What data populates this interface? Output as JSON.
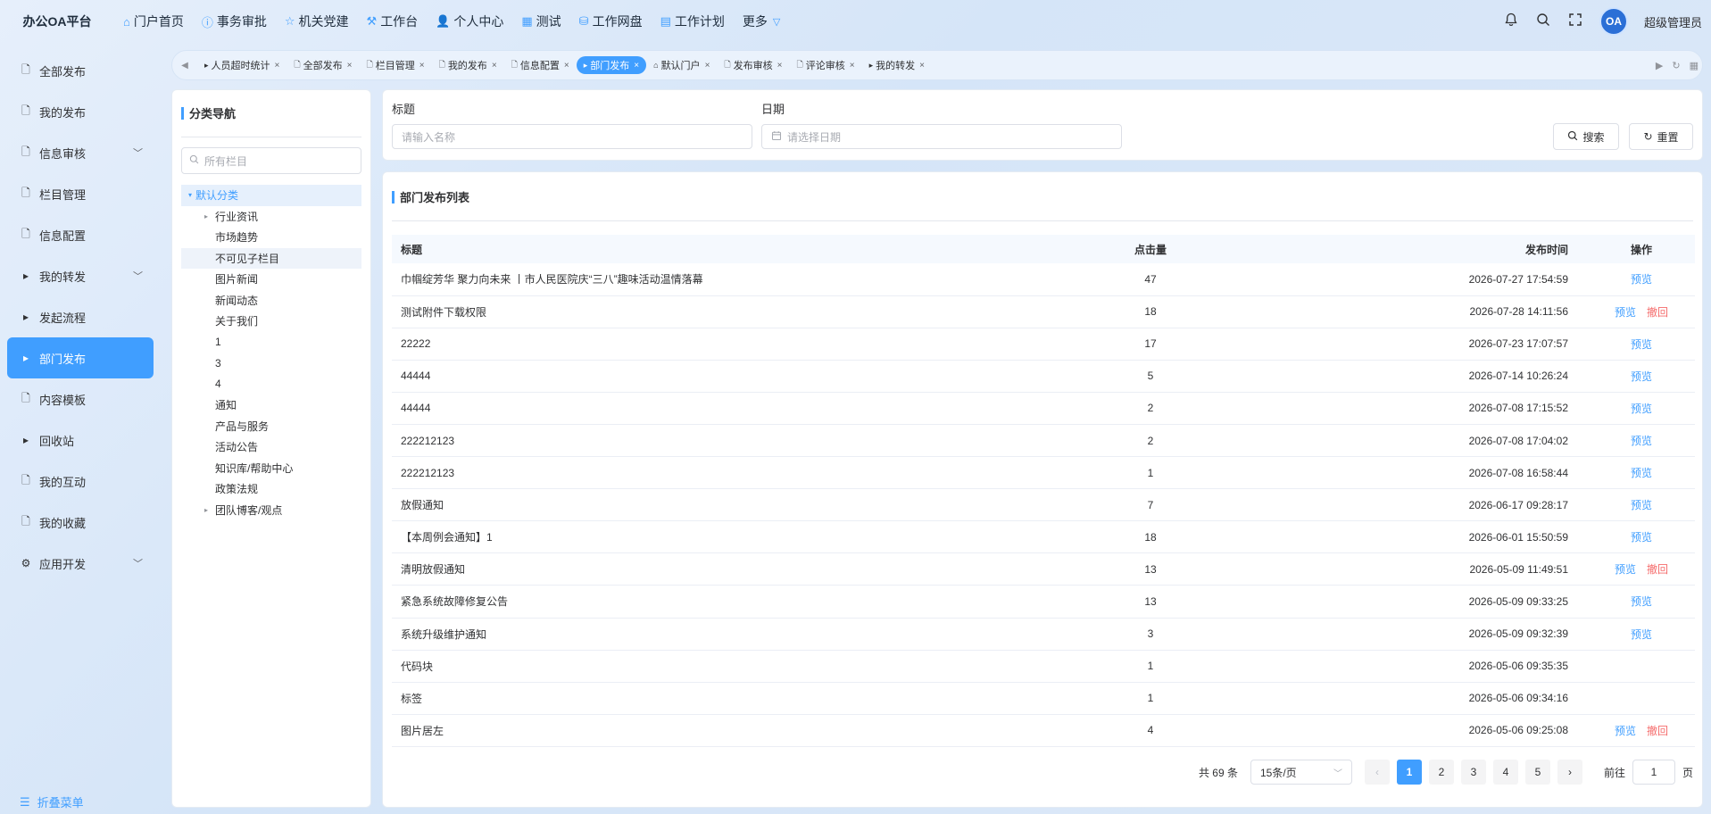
{
  "app": {
    "title": "办公OA平台"
  },
  "topnav": [
    {
      "label": "门户首页",
      "icon": "home-icon"
    },
    {
      "label": "事务审批",
      "icon": "info-icon"
    },
    {
      "label": "机关党建",
      "icon": "star-icon"
    },
    {
      "label": "工作台",
      "icon": "workbench-icon"
    },
    {
      "label": "个人中心",
      "icon": "user-icon"
    },
    {
      "label": "测试",
      "icon": "grid-icon"
    },
    {
      "label": "工作网盘",
      "icon": "database-icon"
    },
    {
      "label": "工作计划",
      "icon": "calendar-icon"
    },
    {
      "label": "更多",
      "icon": "chevron-down-icon"
    }
  ],
  "user": {
    "avatar_text": "OA",
    "name": "超级管理员"
  },
  "sidebar": {
    "items": [
      {
        "label": "全部发布",
        "icon": "document-icon"
      },
      {
        "label": "我的发布",
        "icon": "document-icon"
      },
      {
        "label": "信息审核",
        "icon": "document-icon"
      },
      {
        "label": "栏目管理",
        "icon": "document-icon"
      },
      {
        "label": "信息配置",
        "icon": "document-icon"
      },
      {
        "label": "我的转发",
        "icon": "caret-right-icon"
      },
      {
        "label": "发起流程",
        "icon": "caret-right-icon"
      },
      {
        "label": "部门发布",
        "icon": "caret-right-icon",
        "active": true
      },
      {
        "label": "内容模板",
        "icon": "document-icon"
      },
      {
        "label": "回收站",
        "icon": "caret-right-icon"
      },
      {
        "label": "我的互动",
        "icon": "document-icon"
      },
      {
        "label": "我的收藏",
        "icon": "document-icon"
      },
      {
        "label": "应用开发",
        "icon": "gear-icon"
      }
    ],
    "collapse_label": "折叠菜单"
  },
  "tabs": [
    {
      "label": "人员超时统计",
      "icon": "caret-right-icon"
    },
    {
      "label": "全部发布",
      "icon": "document-icon"
    },
    {
      "label": "栏目管理",
      "icon": "document-icon"
    },
    {
      "label": "我的发布",
      "icon": "document-icon"
    },
    {
      "label": "信息配置",
      "icon": "document-icon"
    },
    {
      "label": "部门发布",
      "icon": "caret-right-icon",
      "active": true
    },
    {
      "label": "默认门户",
      "icon": "home-icon"
    },
    {
      "label": "发布审核",
      "icon": "document-icon"
    },
    {
      "label": "评论审核",
      "icon": "document-icon"
    },
    {
      "label": "我的转发",
      "icon": "caret-right-icon"
    }
  ],
  "tree": {
    "title": "分类导航",
    "search_placeholder": "所有栏目",
    "root": "默认分类",
    "children": [
      {
        "label": "行业资讯",
        "expandable": true
      },
      {
        "label": "市场趋势"
      },
      {
        "label": "不可见子栏目",
        "highlight": true
      },
      {
        "label": "图片新闻"
      },
      {
        "label": "新闻动态"
      },
      {
        "label": "关于我们"
      },
      {
        "label": "1"
      },
      {
        "label": "3"
      },
      {
        "label": "4"
      },
      {
        "label": "通知"
      },
      {
        "label": "产品与服务"
      },
      {
        "label": "活动公告"
      },
      {
        "label": "知识库/帮助中心"
      },
      {
        "label": "政策法规"
      },
      {
        "label": "团队博客/观点",
        "expandable": true
      }
    ]
  },
  "search": {
    "title_label": "标题",
    "title_placeholder": "请输入名称",
    "date_label": "日期",
    "date_placeholder": "请选择日期",
    "search_button": "搜索",
    "reset_button": "重置"
  },
  "list": {
    "title": "部门发布列表",
    "columns": [
      "标题",
      "点击量",
      "发布时间",
      "操作"
    ],
    "preview_label": "预览",
    "revoke_label": "撤回",
    "rows": [
      {
        "title": "巾帼绽芳华 聚力向未来 丨市人民医院庆“三八”趣味活动温情落幕",
        "clicks": "47",
        "time": "2026-07-27 17:54:59",
        "preview": true,
        "revoke": false
      },
      {
        "title": "测试附件下载权限",
        "clicks": "18",
        "time": "2026-07-28 14:11:56",
        "preview": true,
        "revoke": true
      },
      {
        "title": "22222",
        "clicks": "17",
        "time": "2026-07-23 17:07:57",
        "preview": true,
        "revoke": false
      },
      {
        "title": "44444",
        "clicks": "5",
        "time": "2026-07-14 10:26:24",
        "preview": true,
        "revoke": false
      },
      {
        "title": "44444",
        "clicks": "2",
        "time": "2026-07-08 17:15:52",
        "preview": true,
        "revoke": false
      },
      {
        "title": "222212123",
        "clicks": "2",
        "time": "2026-07-08 17:04:02",
        "preview": true,
        "revoke": false
      },
      {
        "title": "222212123",
        "clicks": "1",
        "time": "2026-07-08 16:58:44",
        "preview": true,
        "revoke": false
      },
      {
        "title": "放假通知",
        "clicks": "7",
        "time": "2026-06-17 09:28:17",
        "preview": true,
        "revoke": false
      },
      {
        "title": "【本周例会通知】1",
        "clicks": "18",
        "time": "2026-06-01 15:50:59",
        "preview": true,
        "revoke": false
      },
      {
        "title": "清明放假通知",
        "clicks": "13",
        "time": "2026-05-09 11:49:51",
        "preview": true,
        "revoke": true
      },
      {
        "title": "紧急系统故障修复公告",
        "clicks": "13",
        "time": "2026-05-09 09:33:25",
        "preview": true,
        "revoke": false
      },
      {
        "title": "系统升级维护通知",
        "clicks": "3",
        "time": "2026-05-09 09:32:39",
        "preview": true,
        "revoke": false
      },
      {
        "title": "代码块",
        "clicks": "1",
        "time": "2026-05-06 09:35:35",
        "preview": false,
        "revoke": false
      },
      {
        "title": "标签",
        "clicks": "1",
        "time": "2026-05-06 09:34:16",
        "preview": false,
        "revoke": false
      },
      {
        "title": "图片居左",
        "clicks": "4",
        "time": "2026-05-06 09:25:08",
        "preview": true,
        "revoke": true
      }
    ]
  },
  "pagination": {
    "total_text": "共 69 条",
    "page_size": "15条/页",
    "pages": [
      "1",
      "2",
      "3",
      "4",
      "5"
    ],
    "current": "1",
    "goto_label": "前往",
    "goto_value": "1",
    "page_suffix": "页"
  },
  "colors": {
    "accent": "#409eff",
    "danger": "#f56c6c"
  }
}
